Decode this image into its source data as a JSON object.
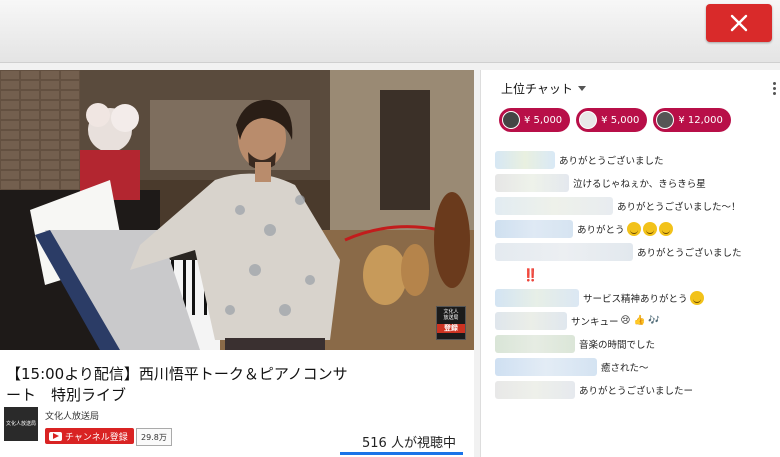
{
  "close_button_glyph": "✕",
  "video": {
    "watermark_lines": [
      "文化人",
      "放送局"
    ],
    "watermark_sub": "登録"
  },
  "info": {
    "title": "【15:00より配信】西川悟平トーク＆ピアノコンサート　特別ライブ",
    "channel_avatar_text": "文化人放送局",
    "channel_name": "文化人放送局",
    "subscribe_label": "チャンネル登録",
    "subscriber_count": "29.8万",
    "viewers": "516 人が視聴中"
  },
  "chat": {
    "header": "上位チャット",
    "tickers": [
      {
        "amount": "¥ 5,000",
        "avatar_color": "#444444"
      },
      {
        "amount": "¥ 5,000",
        "avatar_color": "#e8e8e8"
      },
      {
        "amount": "¥ 12,000",
        "avatar_color": "#555555"
      }
    ],
    "messages": [
      {
        "text": "ありがとうございました",
        "emojis": 0
      },
      {
        "text": "泣けるじゃねぇか、きらきら星",
        "emojis": 0
      },
      {
        "text": "ありがとうございました〜！",
        "emojis": 0
      },
      {
        "text": "ありがとう",
        "emojis": 3
      },
      {
        "text": "ありがとうございました",
        "emojis": 0
      },
      {
        "text": "‼️",
        "emojis": 0
      },
      {
        "text": "サービス精神ありがとう",
        "emojis": 1
      },
      {
        "text": "サンキュー",
        "emojis": 0,
        "extra": "😢 👍 🎶"
      },
      {
        "text": "音楽の時間でした",
        "emojis": 0
      },
      {
        "text": "癒された〜",
        "emojis": 0
      },
      {
        "text": "ありがとうございましたー",
        "emojis": 0
      }
    ]
  },
  "colors": {
    "close_red": "#d92a2a",
    "superchat_magenta": "#b80f48",
    "youtube_red": "#d92323"
  }
}
